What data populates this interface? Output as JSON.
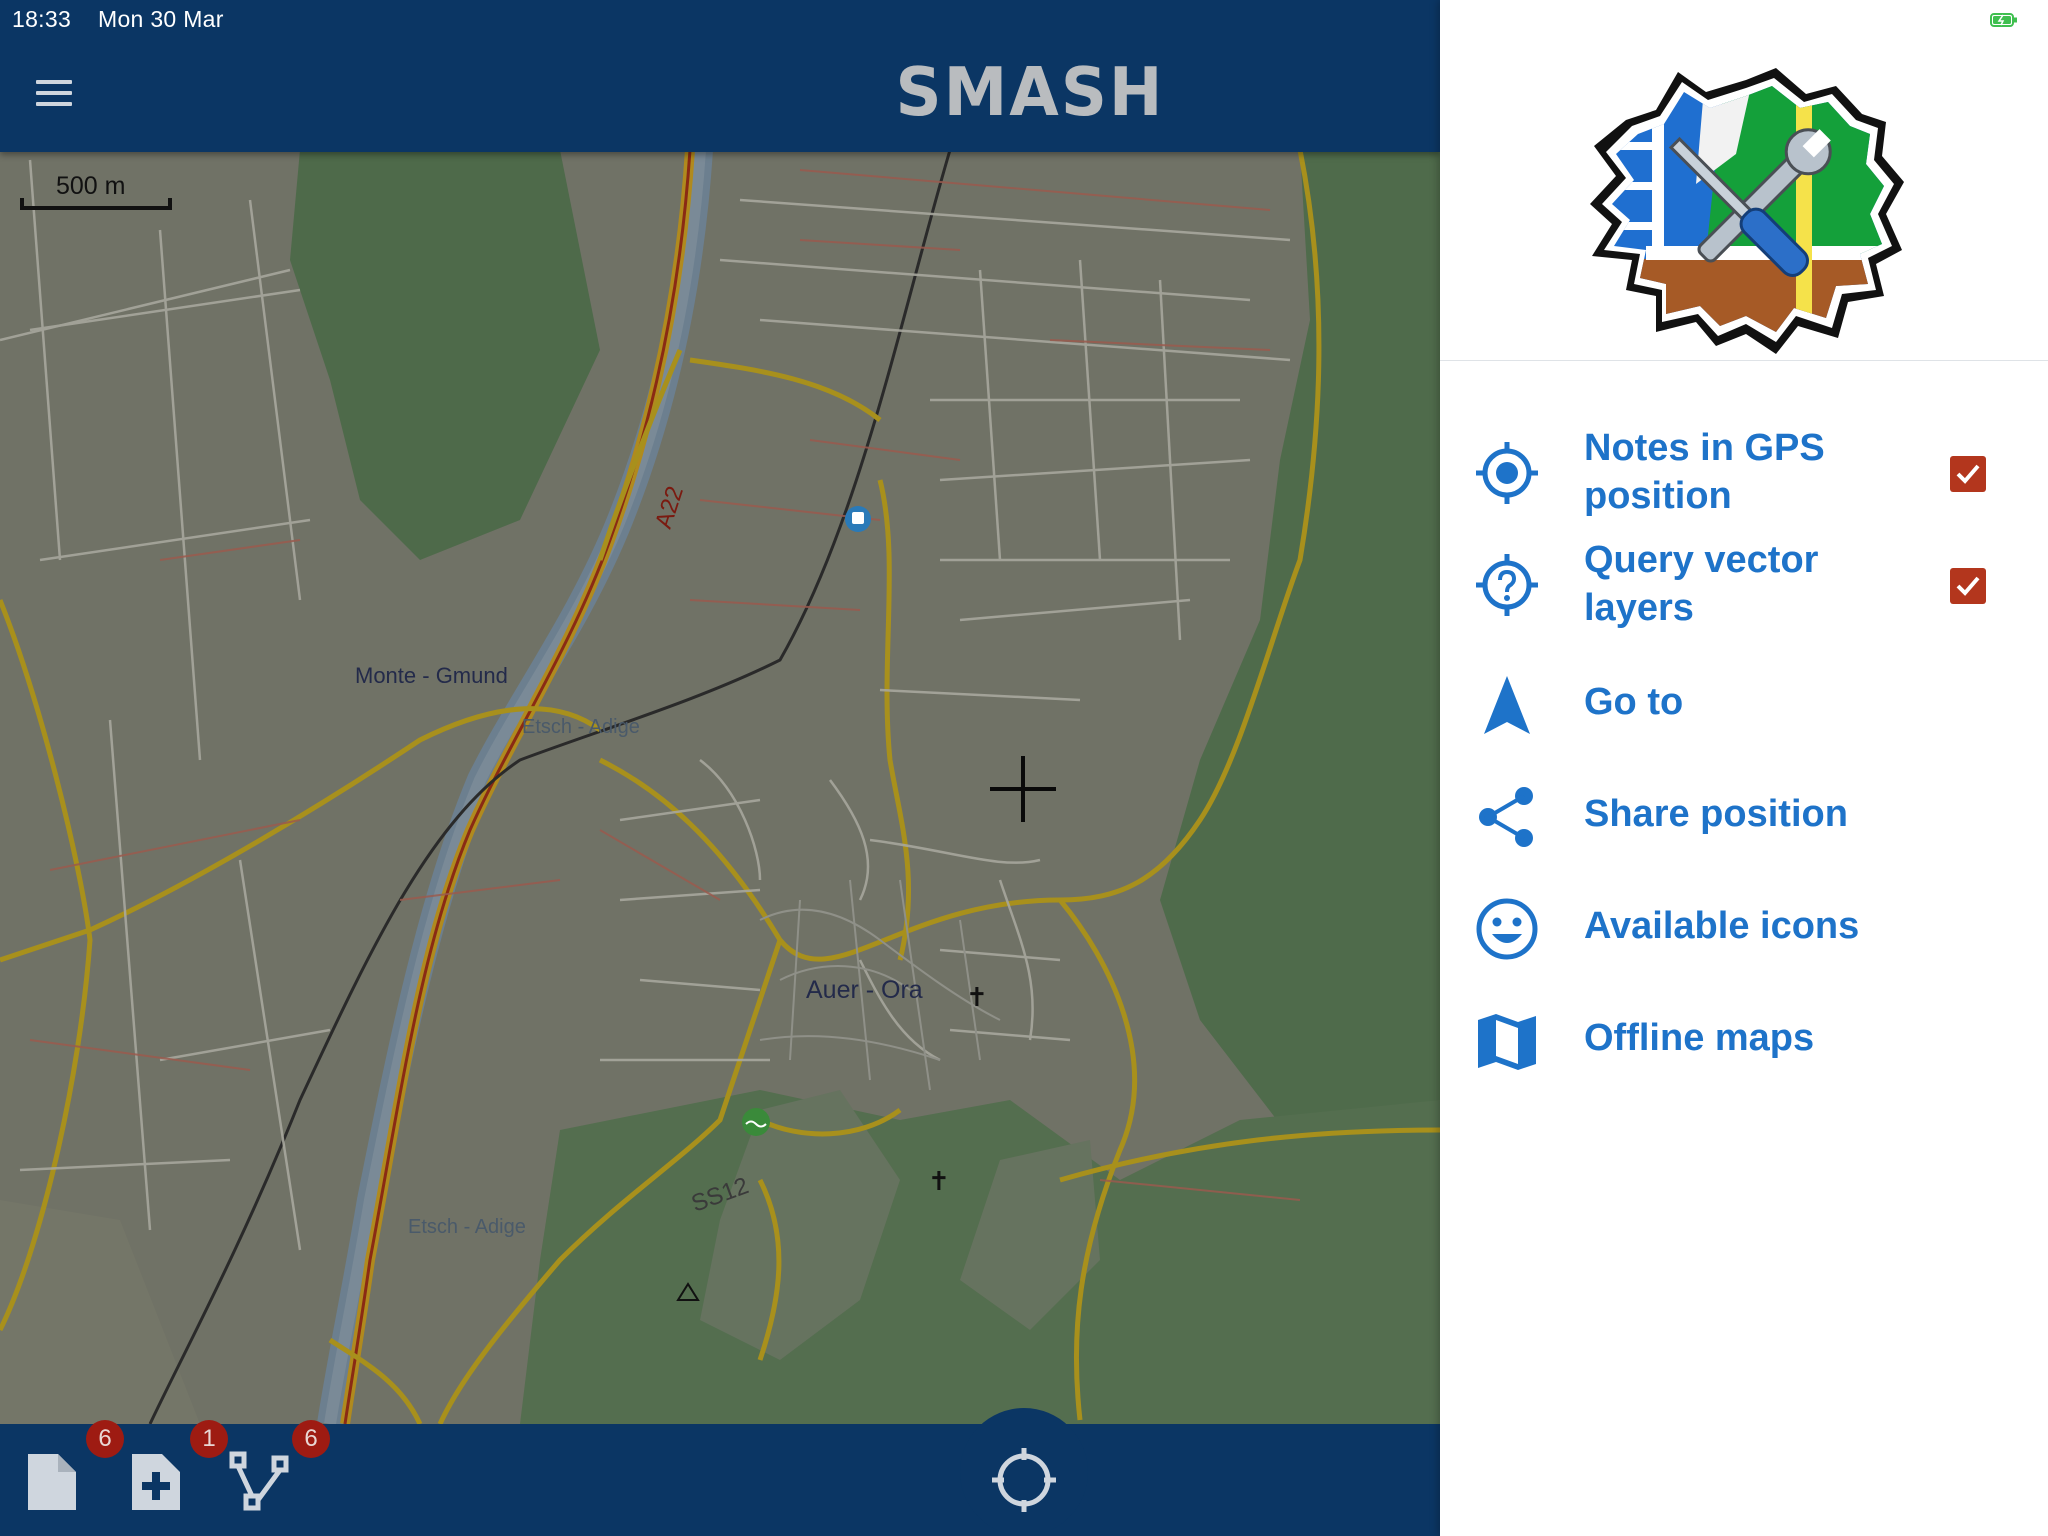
{
  "status_bar": {
    "time": "18:33",
    "date": "Mon 30 Mar"
  },
  "app_bar": {
    "title": "SMASH",
    "menu_icon": "hamburger-menu-icon"
  },
  "map": {
    "scale_label": "500 m",
    "labels": {
      "monte_gmund": "Monte - Gmund",
      "etsch_adige_top": "Etsch - Adige",
      "a22": "A22",
      "auer_ora": "Auer - Ora",
      "ss12": "SS12",
      "etsch_adige_bottom": "Etsch - Adige"
    }
  },
  "bottom_toolbar": {
    "notes_count": "6",
    "form_notes_count": "1",
    "gps_logs_count": "6",
    "icons": [
      "note-icon",
      "add-form-note-icon",
      "gps-log-icon",
      "center-gps-icon"
    ]
  },
  "drawer": {
    "items": [
      {
        "label_line1": "Notes in GPS",
        "label_line2": "position",
        "icon": "gps-fixed-icon",
        "checked": true
      },
      {
        "label_line1": "Query vector",
        "label_line2": "layers",
        "icon": "query-help-icon",
        "checked": true
      },
      {
        "label": "Go to",
        "icon": "navigation-arrow-icon"
      },
      {
        "label": "Share position",
        "icon": "share-icon"
      },
      {
        "label": "Available icons",
        "icon": "smiley-icon"
      },
      {
        "label": "Offline maps",
        "icon": "map-icon"
      }
    ]
  },
  "colors": {
    "app_bar": "#0b3664",
    "drawer_text": "#1e73c9",
    "checkbox": "#b3361d",
    "badge": "#9e1b12"
  }
}
